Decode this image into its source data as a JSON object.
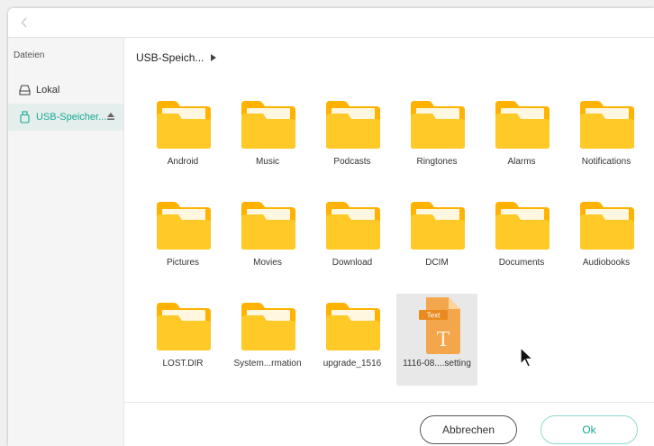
{
  "sidebar": {
    "title": "Dateien",
    "items": [
      {
        "label": "Lokal",
        "icon": "drive-icon"
      },
      {
        "label": "USB-Speicher...",
        "icon": "usb-icon"
      }
    ]
  },
  "breadcrumb": {
    "label": "USB-Speich..."
  },
  "files": [
    {
      "name": "Android",
      "type": "folder"
    },
    {
      "name": "Music",
      "type": "folder"
    },
    {
      "name": "Podcasts",
      "type": "folder"
    },
    {
      "name": "Ringtones",
      "type": "folder"
    },
    {
      "name": "Alarms",
      "type": "folder"
    },
    {
      "name": "Notifications",
      "type": "folder"
    },
    {
      "name": "Pictures",
      "type": "folder"
    },
    {
      "name": "Movies",
      "type": "folder"
    },
    {
      "name": "Download",
      "type": "folder"
    },
    {
      "name": "DCIM",
      "type": "folder"
    },
    {
      "name": "Documents",
      "type": "folder"
    },
    {
      "name": "Audiobooks",
      "type": "folder"
    },
    {
      "name": "LOST.DIR",
      "type": "folder"
    },
    {
      "name": "System...rmation",
      "type": "folder"
    },
    {
      "name": "upgrade_1516",
      "type": "folder"
    },
    {
      "name": "1116-08....setting",
      "type": "text-file",
      "badge": "Text",
      "glyph": "T",
      "selected": true
    }
  ],
  "buttons": {
    "cancel": "Abbrechen",
    "ok": "Ok"
  },
  "colors": {
    "accent": "#17a996",
    "folder": "#ffc107",
    "text_file": "#f0a040"
  }
}
